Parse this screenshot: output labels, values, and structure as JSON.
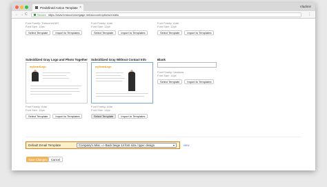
{
  "browser": {
    "tab_title": "Predefined Action Template",
    "tab_close": "×",
    "user_name": "Vladimir",
    "back": "←",
    "forward": "→",
    "reload": "C",
    "secure_label": "Secure",
    "url": "https://www.bmtouchmortgage.net/account/options/emails",
    "menu": "⋮"
  },
  "top_row": [
    {
      "font_family": "Font Family: Trebuchet MS",
      "font_size": "Font Size: 10px",
      "select": "Select Template",
      "import": "Import to Templates"
    },
    {
      "font_family": "Font Family: Arial",
      "font_size": "Font Size: 12px",
      "select": "Select Template",
      "import": "Import to Templates"
    },
    {
      "font_family": "Font Family: Arial",
      "font_size": "Font Size: 12px",
      "select": "Select Template",
      "import": "Import to Templates"
    }
  ],
  "templates": [
    {
      "title": "Subsidiized Gray Logo and Photo Together",
      "logo": "mySmartLogo",
      "font_family": "Font Family: Arial",
      "font_size": "Font Size: 14px",
      "select": "Select Template",
      "import": "Import to Templates"
    },
    {
      "title": "Subsidiized Gray Without Contact Info",
      "logo": "mySmartLogo",
      "font_family": "Font Family: Arial",
      "font_size": "Font Size: 14px",
      "select": "Select Template",
      "import": "Import to Templates"
    }
  ],
  "blank": {
    "title": "Blank",
    "font_family": "Font Family: Verdana",
    "font_size": "Font Size: 14px",
    "select": "Select Template",
    "import": "Import to Templates"
  },
  "default_email": {
    "label": "Default Email Template",
    "selected": "Company's Misc => Back beige 14 font size / type: design",
    "view": "view"
  },
  "actions": {
    "save": "Save Changes",
    "cancel": "Cancel"
  },
  "colors": {
    "highlight_border": "#e07a1f",
    "highlight_bg": "#fdf0c9",
    "save_button": "#f0b45c",
    "link": "#4a7bc7"
  }
}
